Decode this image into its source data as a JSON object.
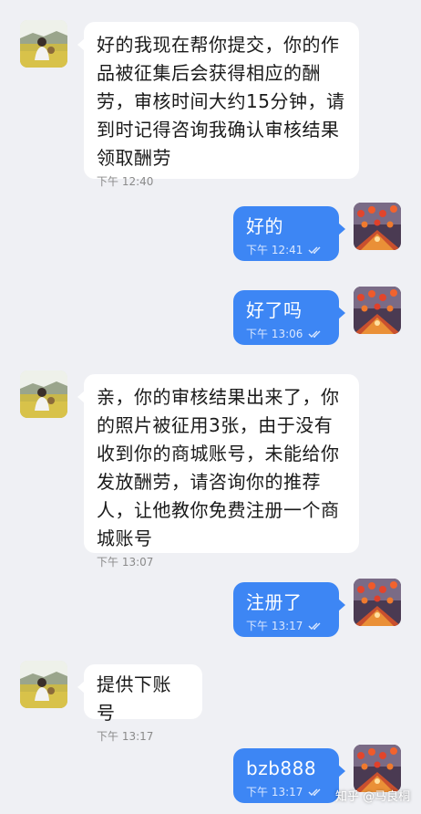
{
  "conversation": [
    {
      "from": "them",
      "text": "好的我现在帮你提交，你的作品被征集后会获得相应的酬劳，审核时间大约15分钟，请到时记得咨询我确认审核结果领取酬劳",
      "time": "下午 12:40"
    },
    {
      "from": "me",
      "text": "好的",
      "time": "下午 12:41"
    },
    {
      "from": "me",
      "text": "好了吗",
      "time": "下午 13:06"
    },
    {
      "from": "them",
      "text": "亲，你的审核结果出来了，你的照片被征用3张，由于没有收到你的商城账号，未能给你发放酬劳，请咨询你的推荐人，让他教你免费注册一个商城账号",
      "time": "下午 13:07"
    },
    {
      "from": "me",
      "text": "注册了",
      "time": "下午 13:17"
    },
    {
      "from": "them",
      "text": "提供下账号",
      "time": "下午 13:17"
    },
    {
      "from": "me",
      "text": "bzb888",
      "time": "下午 13:17"
    }
  ],
  "watermark": "知乎 @马良桐",
  "icons": {
    "them_avatar": "landscape-photo-avatar",
    "me_avatar": "lanterns-photo-avatar",
    "read_receipt": "double-check-icon"
  },
  "colors": {
    "background": "#eff0f4",
    "incoming_bubble": "#ffffff",
    "outgoing_bubble": "#3d86f4"
  }
}
